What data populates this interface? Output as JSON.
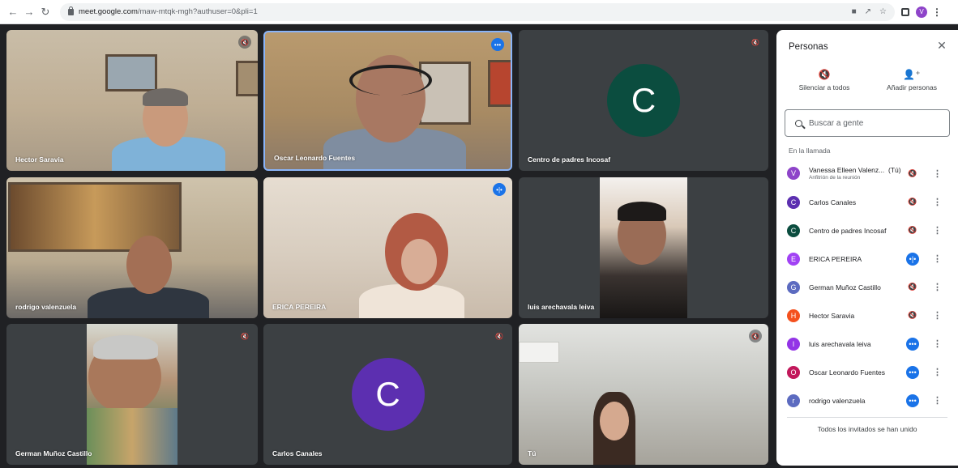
{
  "browser": {
    "url_host": "meet.google.com",
    "url_path": "/maw-mtqk-mgh?authuser=0&pli=1",
    "profile_initial": "V"
  },
  "tiles": [
    {
      "name": "Hector Saravia",
      "badge": "muted"
    },
    {
      "name": "Oscar Leonardo Fuentes",
      "badge": "speaking"
    },
    {
      "name": "Centro de padres Incosaf",
      "badge": "muted",
      "avatar_letter": "C",
      "avatar_color": "#0b4d3f"
    },
    {
      "name": "rodrigo valenzuela",
      "badge": "none"
    },
    {
      "name": "ERICA PEREIRA",
      "badge": "speaking"
    },
    {
      "name": "luis arechavala leiva",
      "badge": "none"
    },
    {
      "name": "German Muñoz Castillo",
      "badge": "muted"
    },
    {
      "name": "Carlos Canales",
      "badge": "muted",
      "avatar_letter": "C",
      "avatar_color": "#5c2fb0"
    },
    {
      "name": "Tú",
      "badge": "muted"
    }
  ],
  "panel": {
    "title": "Personas",
    "mute_all_label": "Silenciar a todos",
    "add_people_label": "Añadir personas",
    "search_placeholder": "Buscar a gente",
    "section_label": "En la llamada",
    "footer_note": "Todos los invitados se han unido",
    "participants": [
      {
        "initial": "V",
        "name": "Vanessa Elleen Valenz...",
        "you": "(Tú)",
        "sub": "Anfitrión de la reunión",
        "color": "#8e44c9",
        "mic": "muted"
      },
      {
        "initial": "C",
        "name": "Carlos Canales",
        "color": "#5c2fb0",
        "mic": "muted"
      },
      {
        "initial": "C",
        "name": "Centro de padres Incosaf",
        "color": "#0b4d3f",
        "mic": "muted"
      },
      {
        "initial": "E",
        "name": "ERICA PEREIRA",
        "color": "#a142f4",
        "mic": "speaking"
      },
      {
        "initial": "G",
        "name": "German Muñoz Castillo",
        "color": "#5c6bc0",
        "mic": "muted"
      },
      {
        "initial": "H",
        "name": "Hector Saravia",
        "color": "#f4511e",
        "mic": "muted"
      },
      {
        "initial": "l",
        "name": "luis arechavala leiva",
        "color": "#9334e6",
        "mic": "speaking"
      },
      {
        "initial": "O",
        "name": "Oscar Leonardo Fuentes",
        "color": "#c2185b",
        "mic": "speaking"
      },
      {
        "initial": "r",
        "name": "rodrigo valenzuela",
        "color": "#5c6bc0",
        "mic": "speaking"
      }
    ]
  }
}
